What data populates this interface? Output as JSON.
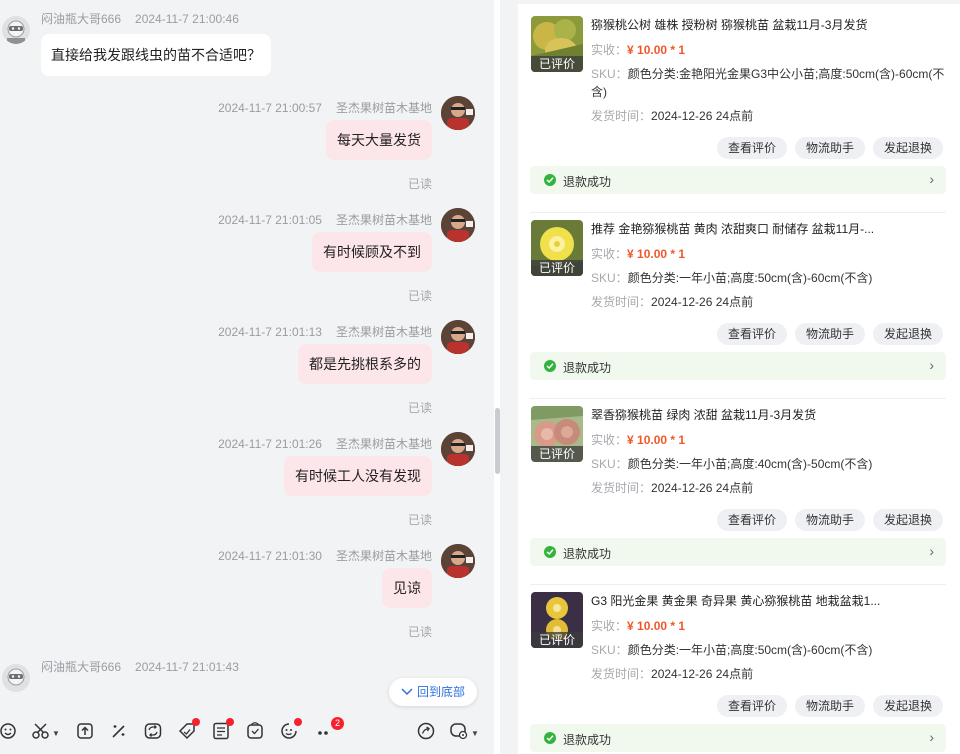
{
  "chat": {
    "messages_in": [
      {
        "name": "闷油瓶大哥666",
        "time": "2024-11-7 21:00:46",
        "text": "直接给我发跟线虫的苗不合适吧？"
      },
      {
        "name": "闷油瓶大哥666",
        "time": "2024-11-7 21:01:43",
        "text": ""
      }
    ],
    "messages_out": [
      {
        "time": "2024-11-7 21:00:57",
        "name": "圣杰果树苗木基地",
        "text": "每天大量发货",
        "status": "已读"
      },
      {
        "time": "2024-11-7 21:01:05",
        "name": "圣杰果树苗木基地",
        "text": "有时候顾及不到",
        "status": "已读"
      },
      {
        "time": "2024-11-7 21:01:13",
        "name": "圣杰果树苗木基地",
        "text": "都是先挑根系多的",
        "status": "已读"
      },
      {
        "time": "2024-11-7 21:01:26",
        "name": "圣杰果树苗木基地",
        "text": "有时候工人没有发现",
        "status": "已读"
      },
      {
        "time": "2024-11-7 21:01:30",
        "name": "圣杰果树苗木基地",
        "text": "见谅",
        "status": "已读"
      }
    ],
    "back_to_bottom": "回到底部",
    "toolbar": {
      "icons": [
        "emoji-icon",
        "scissors-icon",
        "upload-icon",
        "magic-wand-icon",
        "refresh-icon",
        "coupon-icon",
        "order-icon",
        "cart-icon",
        "invite-icon",
        "more-icon",
        "quick-reply-icon",
        "settings-icon"
      ],
      "more_badge": "2"
    }
  },
  "orders": {
    "price_label": "实收：",
    "sku_label": "SKU：",
    "ship_label": "发货时间：",
    "reviewed_tag": "已评价",
    "buttons": [
      "查看评价",
      "物流助手",
      "发起退换"
    ],
    "status": "退款成功",
    "accent_price": "#f0582a",
    "status_bg": "#f1f9ef",
    "items": [
      {
        "title": "猕猴桃公树 雄株 授粉树 猕猴桃苗 盆栽11月-3月发货",
        "price": "¥ 10.00 * 1",
        "sku": "颜色分类:金艳阳光金果G3中公小苗;高度:50cm(含)-60cm(不含)",
        "ship": "2024-12-26 24点前"
      },
      {
        "title": "推荐 金艳猕猴桃苗 黄肉 浓甜爽口 耐储存 盆栽11月-...",
        "price": "¥ 10.00 * 1",
        "sku": "颜色分类:一年小苗;高度:50cm(含)-60cm(不含)",
        "ship": "2024-12-26 24点前"
      },
      {
        "title": "翠香猕猴桃苗 绿肉 浓甜 盆栽11月-3月发货",
        "price": "¥ 10.00 * 1",
        "sku": "颜色分类:一年小苗;高度:40cm(含)-50cm(不含)",
        "ship": "2024-12-26 24点前"
      },
      {
        "title": "G3 阳光金果 黄金果 奇异果 黄心猕猴桃苗 地栽盆栽1...",
        "price": "¥ 10.00 * 1",
        "sku": "颜色分类:一年小苗;高度:50cm(含)-60cm(不含)",
        "ship": "2024-12-26 24点前"
      }
    ]
  }
}
